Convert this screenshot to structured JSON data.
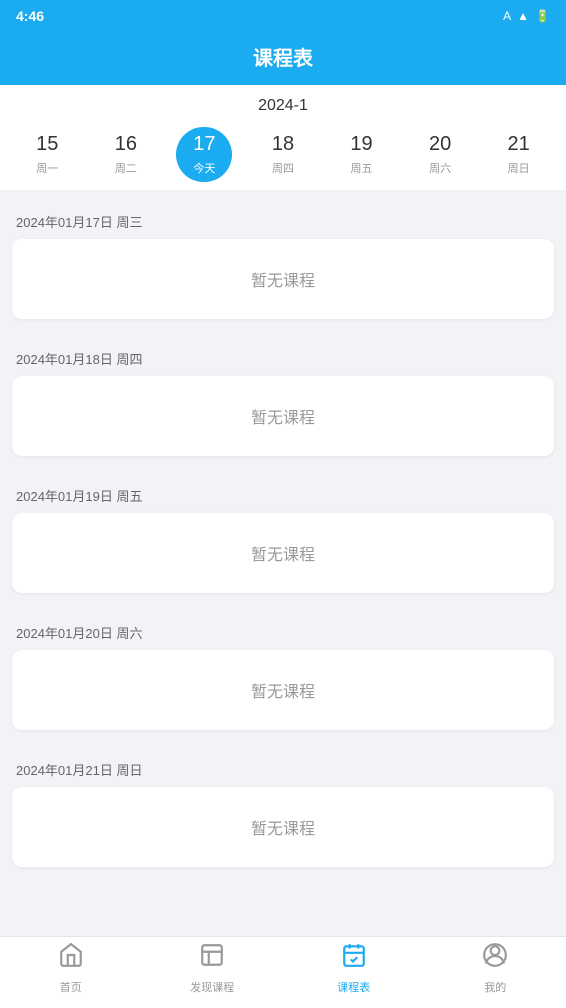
{
  "statusBar": {
    "time": "4:46",
    "icons": [
      "A",
      "wifi",
      "battery"
    ]
  },
  "header": {
    "title": "课程表"
  },
  "weekSelector": {
    "yearLabel": "2024-1",
    "days": [
      {
        "number": "15",
        "label": "周一",
        "active": false
      },
      {
        "number": "16",
        "label": "周二",
        "active": false
      },
      {
        "number": "17",
        "label": "今天",
        "active": true
      },
      {
        "number": "18",
        "label": "周四",
        "active": false
      },
      {
        "number": "19",
        "label": "周五",
        "active": false
      },
      {
        "number": "20",
        "label": "周六",
        "active": false
      },
      {
        "number": "21",
        "label": "周日",
        "active": false
      }
    ]
  },
  "dateSections": [
    {
      "date": "2024年01月17日 周三",
      "noCourse": "暂无课程"
    },
    {
      "date": "2024年01月18日 周四",
      "noCourse": "暂无课程"
    },
    {
      "date": "2024年01月19日 周五",
      "noCourse": "暂无课程"
    },
    {
      "date": "2024年01月20日 周六",
      "noCourse": "暂无课程"
    },
    {
      "date": "2024年01月21日 周日",
      "noCourse": "暂无课程"
    }
  ],
  "bottomNav": [
    {
      "label": "首页",
      "icon": "home",
      "active": false
    },
    {
      "label": "发现课程",
      "icon": "discover",
      "active": false
    },
    {
      "label": "课程表",
      "icon": "schedule",
      "active": true
    },
    {
      "label": "我的",
      "icon": "profile",
      "active": false
    }
  ]
}
